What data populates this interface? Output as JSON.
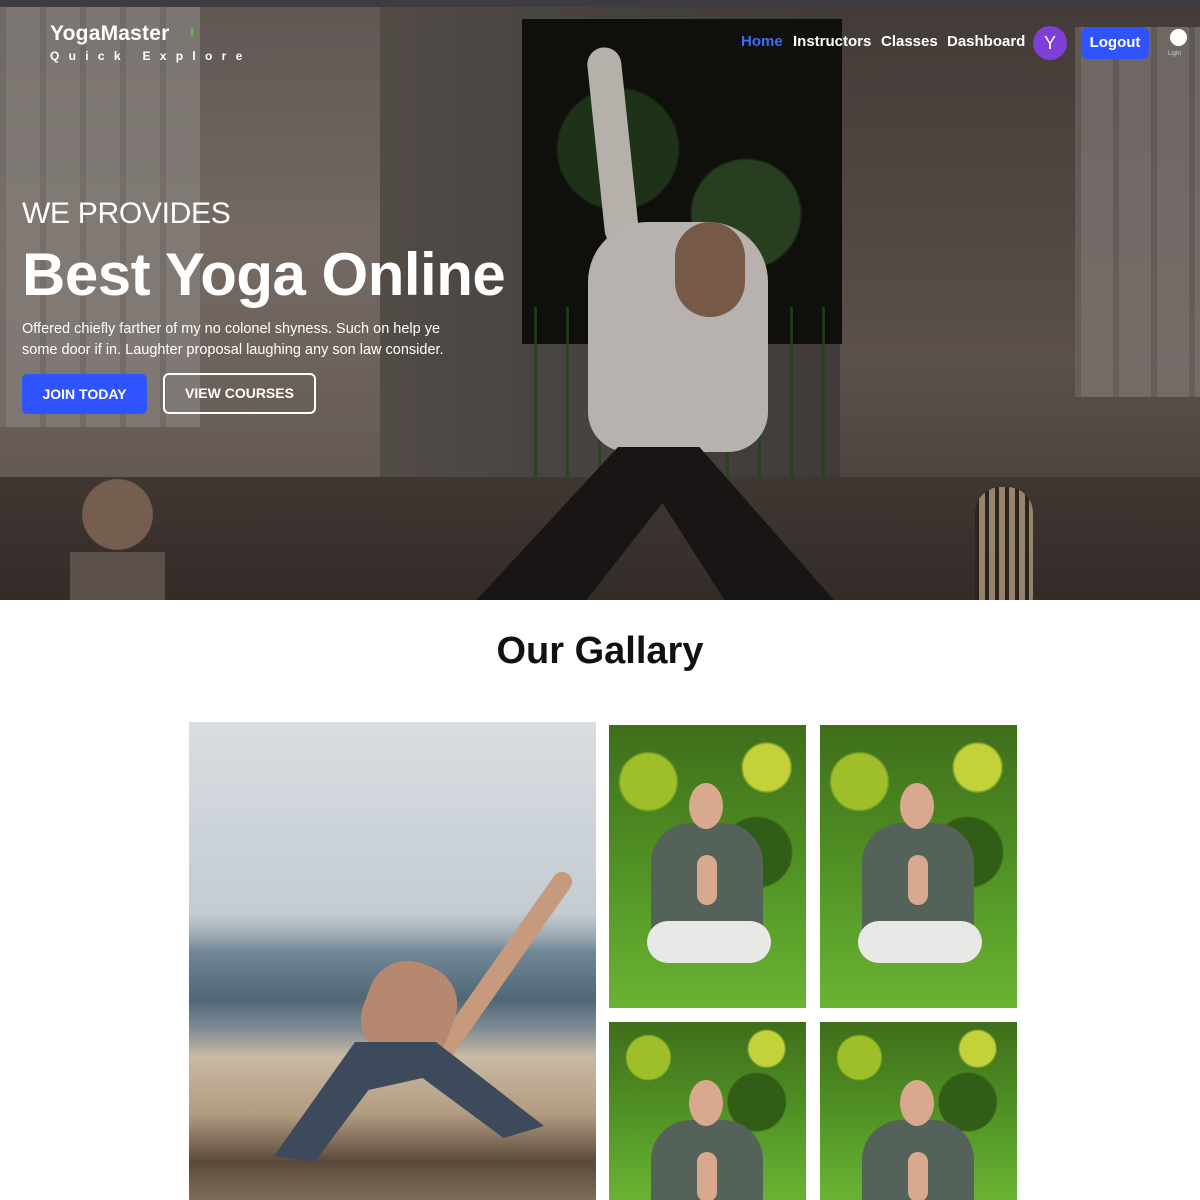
{
  "nav": {
    "logo_title": "YogaMaster",
    "logo_subtitle": "Quick Explore",
    "links": [
      {
        "label": "Home",
        "active": true
      },
      {
        "label": "Instructors",
        "active": false
      },
      {
        "label": "Classes",
        "active": false
      },
      {
        "label": "Dashboard",
        "active": false
      }
    ],
    "avatar_initial": "Y",
    "logout_label": "Logout",
    "theme_toggle_label": "Light"
  },
  "hero": {
    "kicker": "WE PROVIDES",
    "title": "Best Yoga Online",
    "description": "Offered chiefly farther of my no colonel shyness. Such on help ye some door if in. Laughter proposal laughing any son law consider.",
    "primary_button": "JOIN TODAY",
    "secondary_button": "VIEW COURSES"
  },
  "gallery": {
    "title": "Our Gallary"
  },
  "colors": {
    "accent": "#2f54ff",
    "active_nav": "#3b6cff",
    "avatar_bg": "#7e3fd6"
  }
}
